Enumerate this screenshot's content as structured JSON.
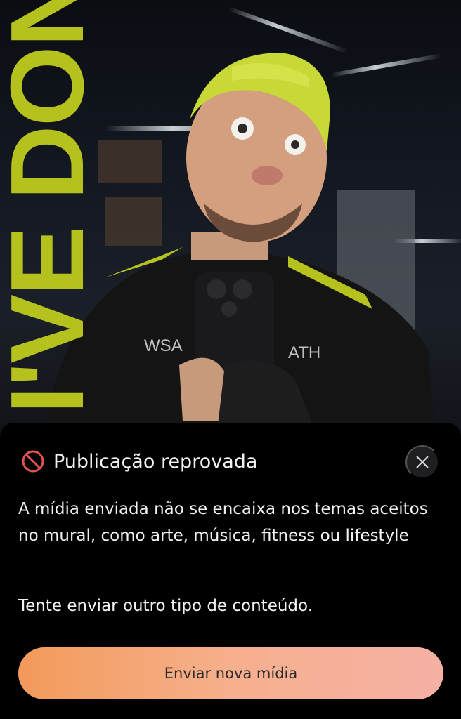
{
  "photo": {
    "overlay_word": "I'VE DONE?",
    "overlay_color": "#b5c21d"
  },
  "sheet": {
    "icon": "ban-icon",
    "title": "Publicação reprovada",
    "close_icon": "close-icon",
    "description": "A mídia enviada não se encaixa nos temas aceitos no mural, como arte, música, fitness ou lifestyle",
    "hint": "Tente enviar outro tipo de conteúdo.",
    "cta_label": "Enviar nova mídia",
    "accent_start": "#f39a5a",
    "accent_end": "#f6b1a6",
    "error_color": "#e0524f"
  }
}
